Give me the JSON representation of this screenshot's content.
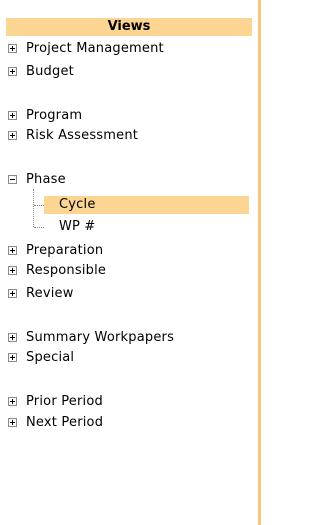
{
  "header": {
    "title": "Views"
  },
  "tree": [
    {
      "label": "Project Management",
      "expanded": false
    },
    {
      "label": "Budget",
      "expanded": false
    },
    {
      "label": "Program",
      "expanded": false
    },
    {
      "label": "Risk Assessment",
      "expanded": false
    },
    {
      "label": "Phase",
      "expanded": true,
      "children": [
        {
          "label": "Cycle",
          "selected": true
        },
        {
          "label": "WP #",
          "selected": false
        }
      ]
    },
    {
      "label": "Preparation",
      "expanded": false
    },
    {
      "label": "Responsible",
      "expanded": false
    },
    {
      "label": "Review",
      "expanded": false
    },
    {
      "label": "Summary Workpapers",
      "expanded": false
    },
    {
      "label": "Special",
      "expanded": false
    },
    {
      "label": "Prior Period",
      "expanded": false
    },
    {
      "label": "Next Period",
      "expanded": false
    }
  ],
  "colors": {
    "header_bg": "#fcd592",
    "selected_bg": "#fcd592",
    "border": "#f5c97a"
  }
}
